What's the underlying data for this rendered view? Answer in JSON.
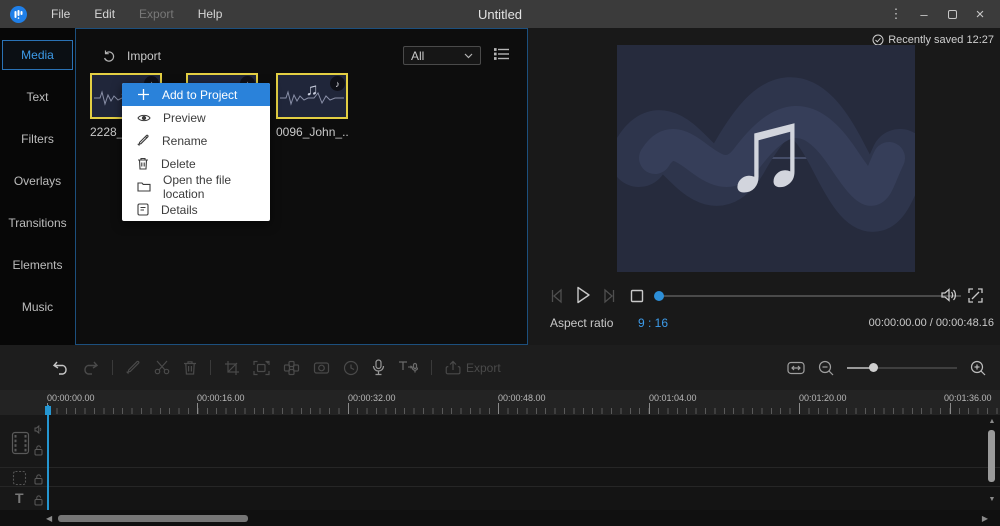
{
  "titlebar": {
    "title": "Untitled",
    "menus": [
      {
        "label": "File"
      },
      {
        "label": "Edit"
      },
      {
        "label": "Export"
      },
      {
        "label": "Help"
      }
    ]
  },
  "window_glyphs": {
    "menu_dots": "⋮",
    "minimize": "–",
    "close": "×"
  },
  "sidebar": {
    "items": [
      {
        "label": "Media"
      },
      {
        "label": "Text"
      },
      {
        "label": "Filters"
      },
      {
        "label": "Overlays"
      },
      {
        "label": "Transitions"
      },
      {
        "label": "Elements"
      },
      {
        "label": "Music"
      }
    ]
  },
  "media": {
    "import_label": "Import",
    "filter_value": "All",
    "items": [
      {
        "name": "2228_"
      },
      {
        "name": ""
      },
      {
        "name": "0096_John_..."
      }
    ]
  },
  "context_menu": {
    "items": [
      {
        "label": "Add to Project"
      },
      {
        "label": "Preview"
      },
      {
        "label": "Rename"
      },
      {
        "label": "Delete"
      },
      {
        "label": "Open the file location"
      },
      {
        "label": "Details"
      }
    ]
  },
  "preview": {
    "saved_status": "Recently saved 12:27",
    "aspect_ratio_label": "Aspect ratio",
    "aspect_ratio_value": "9 : 16",
    "time_display": "00:00:00.00 / 00:00:48.16"
  },
  "toolbar": {
    "export_label": "Export"
  },
  "timeline": {
    "ruler_labels": [
      "00:00:00.00",
      "00:00:16.00",
      "00:00:32.00",
      "00:00:48.00",
      "00:01:04.00",
      "00:01:20.00",
      "00:01:36.00"
    ]
  },
  "glyphs": {
    "music_note": "♪",
    "big_music_note": "♫",
    "text_track": "T",
    "scroll_up": "▲",
    "scroll_down": "▼",
    "scroll_left": "◀",
    "scroll_right": "▶"
  },
  "colors": {
    "accent_blue": "#2a82da",
    "selection_yellow": "#e3cf43",
    "playhead_blue": "#2596d1",
    "link_blue": "#3d9be9"
  }
}
